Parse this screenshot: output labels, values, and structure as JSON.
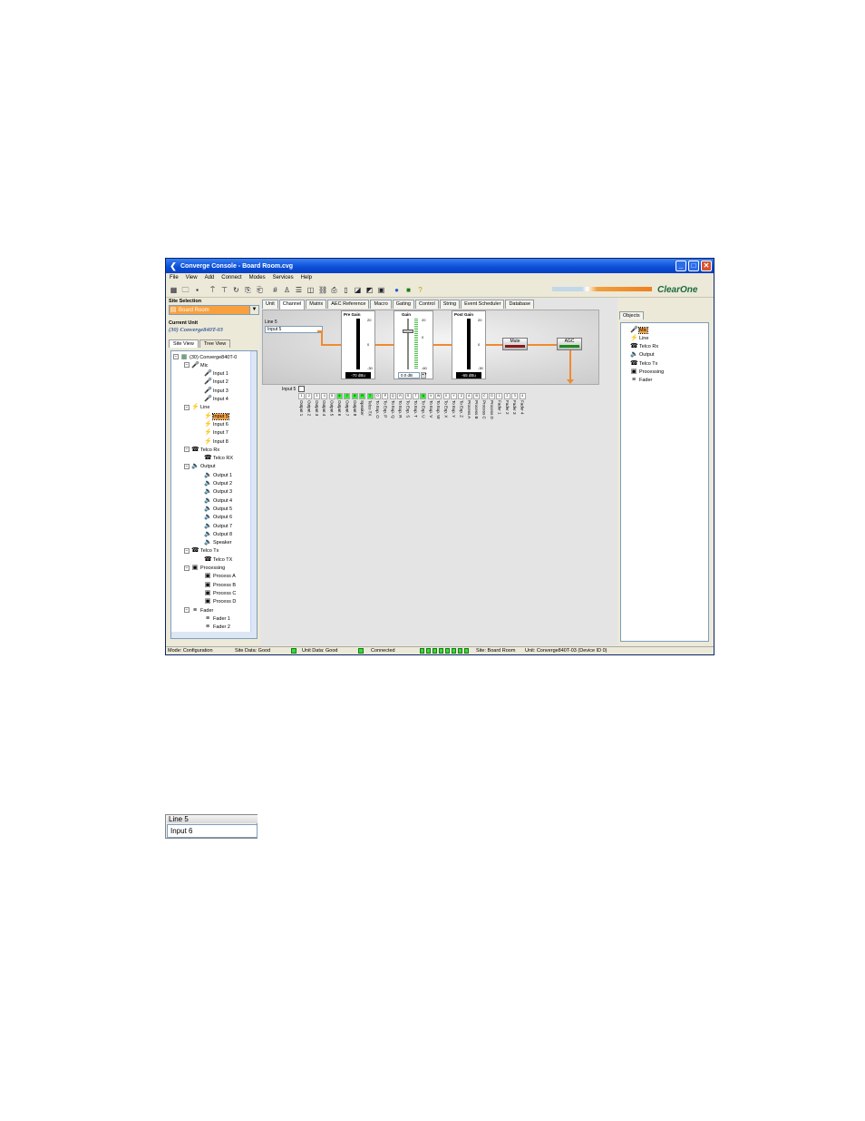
{
  "window": {
    "title": "Converge Console - Board Room.cvg",
    "brand": "ClearOne"
  },
  "menu": [
    "File",
    "View",
    "Add",
    "Connect",
    "Modes",
    "Services",
    "Help"
  ],
  "left_panel": {
    "site_selection_label": "Site Selection",
    "site_value": "Board Room",
    "current_unit_label": "Current Unit",
    "current_unit_value": "(30) Converge840T-03",
    "view_tabs": [
      "Site View",
      "Tree View"
    ],
    "tree": {
      "root": "(30) Converge840T-0",
      "groups": [
        {
          "label": "Mic",
          "items": [
            "Input 1",
            "Input 2",
            "Input 3",
            "Input 4"
          ]
        },
        {
          "label": "Line",
          "items": [
            "Input 5",
            "Input 6",
            "Input 7",
            "Input 8"
          ]
        },
        {
          "label": "Telco Rx",
          "items": [
            "Telco RX"
          ]
        },
        {
          "label": "Output",
          "items": [
            "Output 1",
            "Output 2",
            "Output 3",
            "Output 4",
            "Output 5",
            "Output 6",
            "Output 7",
            "Output 8",
            "Speaker"
          ]
        },
        {
          "label": "Telco Tx",
          "items": [
            "Telco TX"
          ]
        },
        {
          "label": "Processing",
          "items": [
            "Process A",
            "Process B",
            "Process C",
            "Process D"
          ]
        },
        {
          "label": "Fader",
          "items": [
            "Fader 1",
            "Fader 2"
          ]
        }
      ],
      "selected": "Input 5"
    }
  },
  "tabs": [
    "Unit",
    "Channel",
    "Matrix",
    "AEC Reference",
    "Macro",
    "Gating",
    "Control",
    "String",
    "Event Scheduler",
    "Database"
  ],
  "active_tab": "Channel",
  "channel": {
    "label": "Line 5",
    "name": "Input 5",
    "pre_gain": {
      "title": "Pre Gain",
      "readout": "-70 dBu",
      "ticks": [
        "20",
        "0",
        "-30"
      ]
    },
    "gain": {
      "title": "Gain",
      "readout": "0.0 dB",
      "ticks": [
        "20",
        "0",
        "-60"
      ]
    },
    "post_gain": {
      "title": "Post Gain",
      "readout": "-65 dBu",
      "ticks": [
        "20",
        "0",
        "-30"
      ]
    },
    "mute_label": "Mute",
    "agc_label": "AGC"
  },
  "matrix": {
    "row_label": "Input 5",
    "cells": [
      "1",
      "2",
      "3",
      "4",
      "5",
      "6",
      "7",
      "8",
      "R",
      "T",
      "O",
      "P",
      "Q",
      "R",
      "S",
      "T",
      "U",
      "V",
      "W",
      "X",
      "Y",
      "Z",
      "A",
      "B",
      "C",
      "D",
      "1",
      "2",
      "3",
      "4"
    ],
    "on_cells": [
      5,
      6,
      7,
      8,
      9,
      16
    ],
    "columns": [
      "Output 1",
      "Output 2",
      "Output 3",
      "Output 4",
      "Output 5",
      "Output 6",
      "Output 7",
      "Output 8",
      "Speaker",
      "Telco TX",
      "To Exp. O",
      "To Exp. P",
      "To Exp. Q",
      "To Exp. R",
      "To Exp. S",
      "To Exp. T",
      "To Exp. U",
      "To Exp. V",
      "To Exp. W",
      "To Exp. X",
      "To Exp. Y",
      "To Exp. Z",
      "Process A",
      "Process B",
      "Process C",
      "Process D",
      "Fader 1",
      "Fader 2",
      "Fader 3",
      "Fader 4"
    ]
  },
  "objects": {
    "tab": "Objects",
    "items": [
      "Mic",
      "Line",
      "Telco Rx",
      "Output",
      "Telco Tx",
      "Processing",
      "Fader"
    ],
    "selected": "Mic"
  },
  "status": {
    "mode": "Mode: Configuration",
    "site_data": "Site Data: Good",
    "unit_data": "Unit Data: Good",
    "connected": "Connected",
    "site": "Site: Board Room",
    "unit": "Unit: Converge840T-03 (Device ID 0)"
  },
  "zoom_detail": {
    "label": "Line 5",
    "value": "Input 6"
  },
  "colors": {
    "accent": "#f8a040",
    "title_blue": "#0a4ed8",
    "led_green": "#33ee33",
    "brand_green": "#1a6a3a"
  }
}
